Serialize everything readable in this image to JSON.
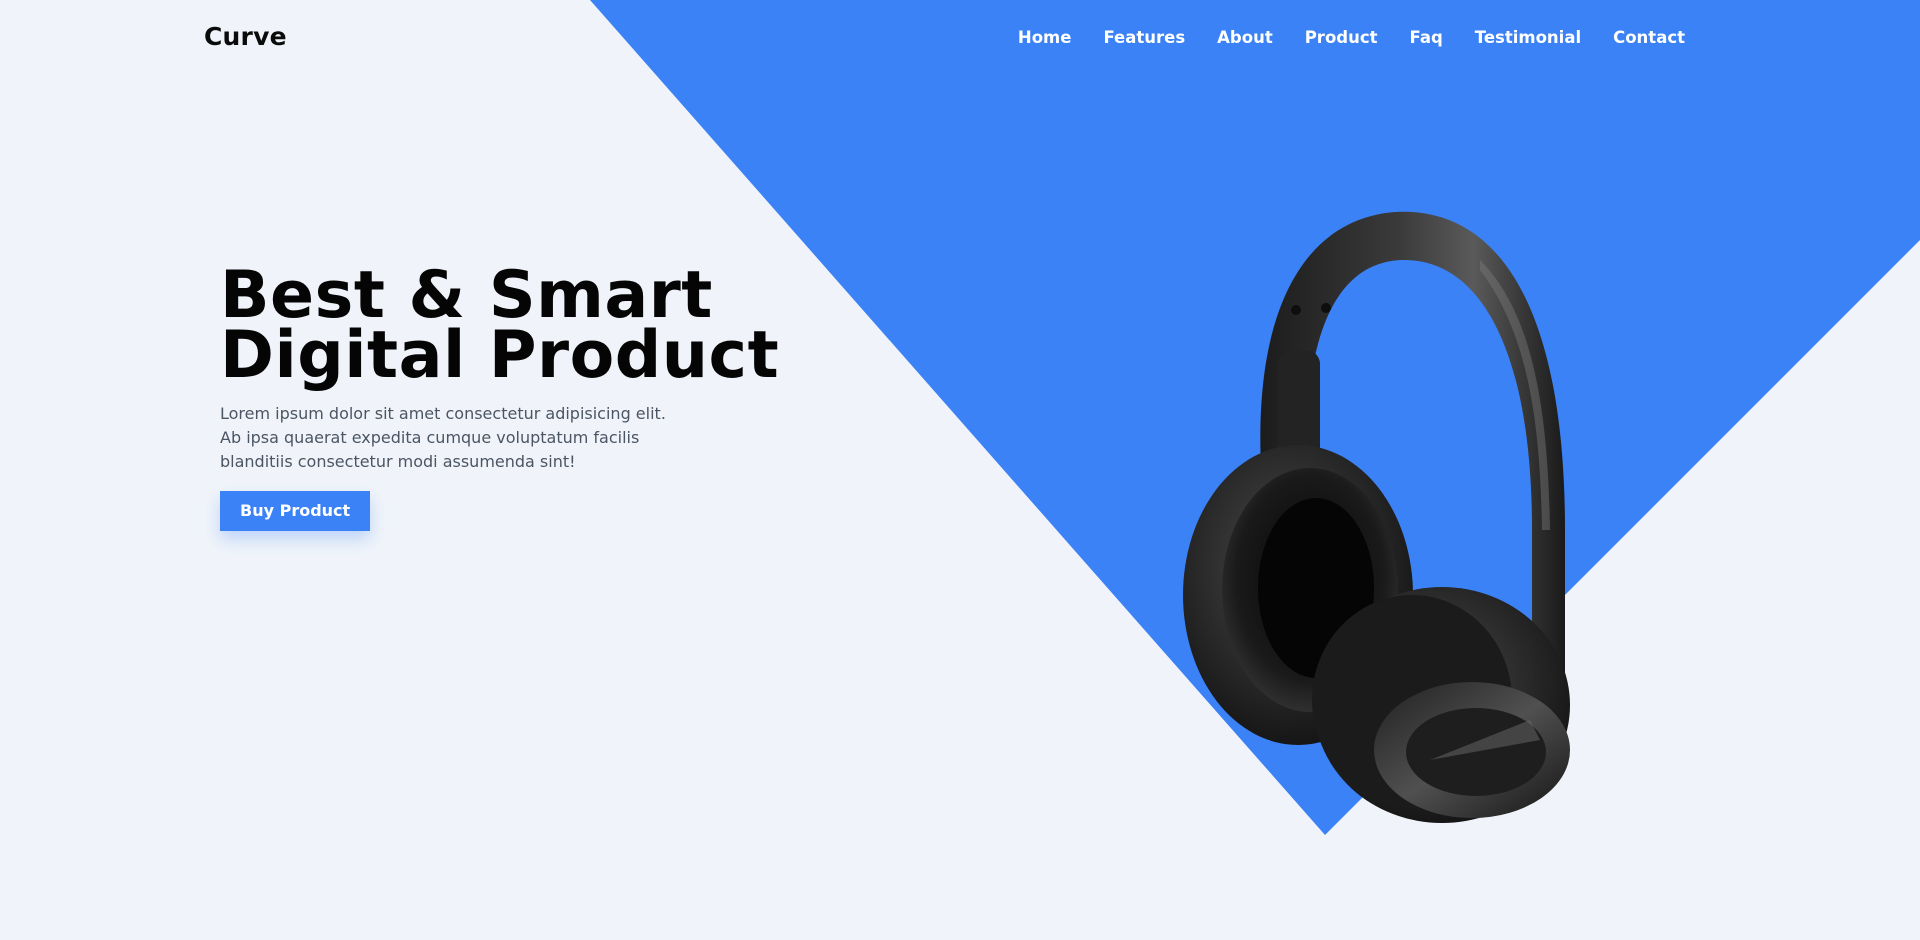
{
  "colors": {
    "background": "#f0f4fa",
    "accent": "#3b82f6",
    "heading": "#050505",
    "body_text": "#4b5563",
    "nav_text": "#ffffff"
  },
  "header": {
    "brand": "Curve",
    "nav": [
      {
        "label": "Home"
      },
      {
        "label": "Features"
      },
      {
        "label": "About"
      },
      {
        "label": "Product"
      },
      {
        "label": "Faq"
      },
      {
        "label": "Testimonial"
      },
      {
        "label": "Contact"
      }
    ]
  },
  "hero": {
    "title_line1": "Best & Smart",
    "title_line2": "Digital Product",
    "description": "Lorem ipsum dolor sit amet consectetur adipisicing elit. Ab ipsa quaerat expedita cumque voluptatum facilis blanditiis consectetur modi assumenda sint!",
    "button_label": "Buy Product"
  },
  "product": {
    "icon": "headphones-icon"
  }
}
